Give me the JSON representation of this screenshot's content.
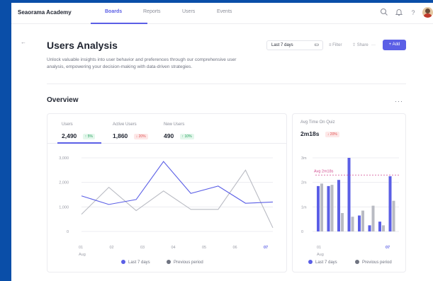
{
  "header": {
    "brand": "Seaorama Academy",
    "nav": [
      {
        "label": "Boards",
        "active": true
      },
      {
        "label": "Reports",
        "active": false
      },
      {
        "label": "Users",
        "active": false
      },
      {
        "label": "Events",
        "active": false
      }
    ],
    "icons": [
      "search-icon",
      "bell-icon",
      "help-icon",
      "avatar"
    ]
  },
  "page": {
    "title": "Users Analysis",
    "description": "Unlock valuable insights into user behavior and preferences through our comprehensive user analysis, empowering your decision-making with data-driven strategies.",
    "date_range": "Last 7 days",
    "filter_label": "Filter",
    "share_label": "Share",
    "more_label": "···",
    "add_label": "+ Add"
  },
  "overview": {
    "title": "Overview",
    "more": "···",
    "metrics": [
      {
        "label": "Users",
        "value": "2,490",
        "delta": "↑ 5%",
        "trend": "up"
      },
      {
        "label": "Active Users",
        "value": "1,860",
        "delta": "↓ 20%",
        "trend": "down"
      },
      {
        "label": "New Users",
        "value": "490",
        "delta": "↑ 10%",
        "trend": "up"
      }
    ],
    "side_metric": {
      "label": "Avg Time On Quiz",
      "value": "2m18s",
      "delta": "↓ 20%",
      "trend": "down"
    },
    "legend": {
      "current": "Last 7 days",
      "previous": "Previous period"
    }
  },
  "colors": {
    "accent": "#5b5fe6",
    "previous": "#b9bbc3",
    "up": "#22a05a",
    "down": "#e05252",
    "avg_line": "#d14b8f"
  },
  "chart_data": [
    {
      "type": "line",
      "x": [
        "01",
        "02",
        "03",
        "04",
        "05",
        "06",
        "07"
      ],
      "x_sublabel": "Aug",
      "yticks": [
        "0",
        "1,000",
        "2,000",
        "3,000"
      ],
      "ylim": [
        0,
        3000
      ],
      "series": [
        {
          "name": "Last 7 days",
          "values": [
            1450,
            1100,
            1300,
            2850,
            1550,
            1850,
            1150,
            1200
          ]
        },
        {
          "name": "Previous period",
          "values": [
            700,
            1800,
            850,
            1650,
            900,
            900,
            2500,
            150
          ]
        }
      ]
    },
    {
      "type": "bar",
      "x": [
        "01",
        "07"
      ],
      "x_sublabel": "Aug",
      "yticks": [
        "0",
        "1m",
        "2m",
        "3m"
      ],
      "ylim": [
        0,
        3
      ],
      "avg_label": "Avg 2m18s",
      "avg_value": 2.3,
      "series": [
        {
          "name": "Last 7 days",
          "values": [
            1.85,
            1.85,
            2.1,
            3.0,
            0.65,
            0.25,
            0.4,
            2.25
          ]
        },
        {
          "name": "Previous period",
          "values": [
            1.95,
            1.9,
            0.75,
            0.6,
            0.85,
            1.05,
            0.25,
            1.25
          ]
        }
      ]
    }
  ]
}
